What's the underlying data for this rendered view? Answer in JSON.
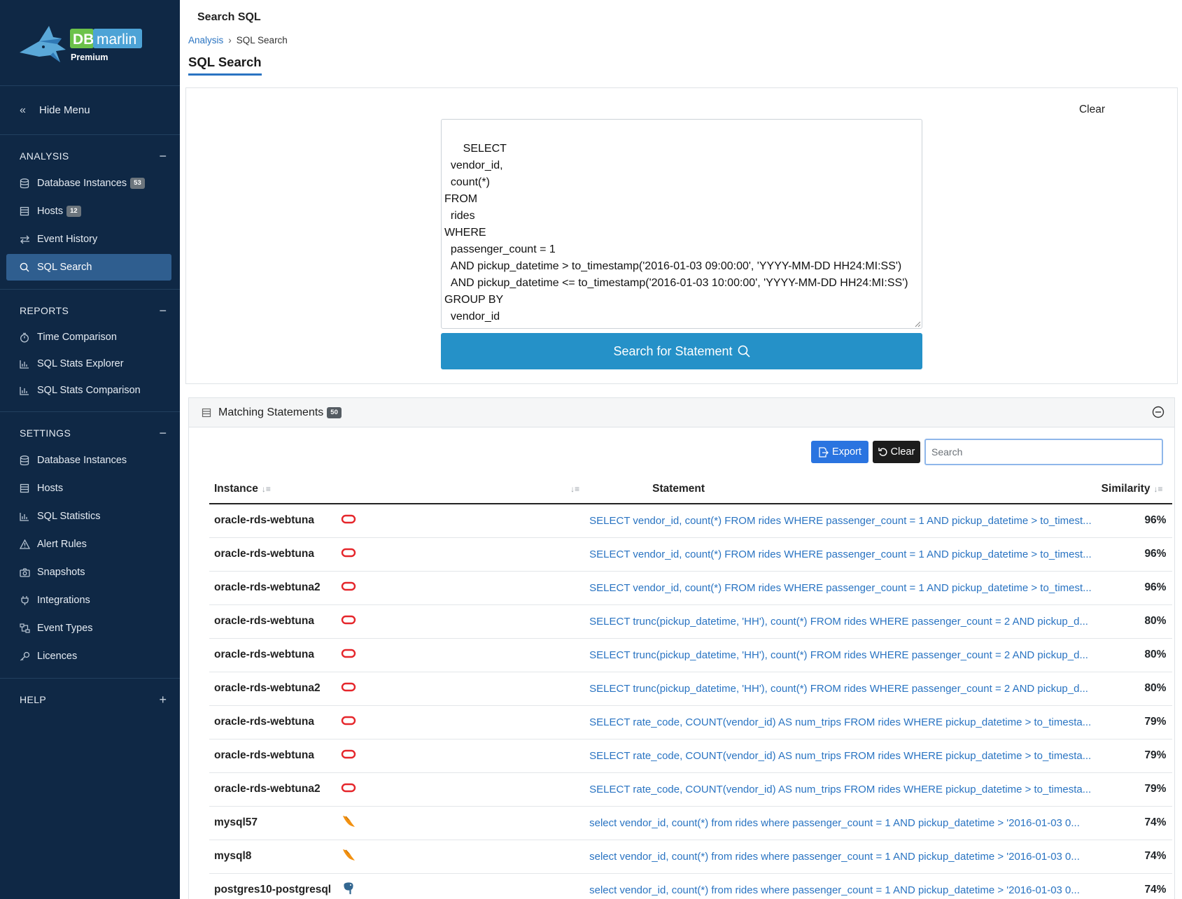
{
  "brand": {
    "logo_text_db": "DB",
    "logo_text_marlin": "marlin",
    "edition": "Premium"
  },
  "sidebar": {
    "hide_menu": "Hide Menu",
    "sections": {
      "analysis": {
        "title": "ANALYSIS",
        "toggle": "−",
        "items": [
          {
            "label": "Database Instances",
            "badge": "53",
            "icon": "database-icon"
          },
          {
            "label": "Hosts",
            "badge": "12",
            "icon": "server-icon"
          },
          {
            "label": "Event History",
            "icon": "arrows-icon"
          },
          {
            "label": "SQL Search",
            "icon": "search-icon",
            "active": true
          }
        ]
      },
      "reports": {
        "title": "REPORTS",
        "toggle": "−",
        "items": [
          {
            "label": "Time Comparison",
            "icon": "stopwatch-icon"
          },
          {
            "label": "SQL Stats Explorer",
            "icon": "bar-chart-icon"
          },
          {
            "label": "SQL Stats Comparison",
            "icon": "bar-chart-icon"
          }
        ]
      },
      "settings": {
        "title": "SETTINGS",
        "toggle": "−",
        "items": [
          {
            "label": "Database Instances",
            "icon": "database-icon"
          },
          {
            "label": "Hosts",
            "icon": "server-icon"
          },
          {
            "label": "SQL Statistics",
            "icon": "bar-chart-icon"
          },
          {
            "label": "Alert Rules",
            "icon": "warning-icon"
          },
          {
            "label": "Snapshots",
            "icon": "camera-icon"
          },
          {
            "label": "Integrations",
            "icon": "plug-icon"
          },
          {
            "label": "Event Types",
            "icon": "diagram-icon"
          },
          {
            "label": "Licences",
            "icon": "key-icon"
          }
        ]
      },
      "help": {
        "title": "HELP",
        "toggle": "+"
      }
    }
  },
  "header": {
    "title": "Search SQL",
    "breadcrumb": {
      "parent": "Analysis",
      "current": "SQL Search"
    },
    "tab": "SQL Search"
  },
  "search": {
    "clear_label": "Clear",
    "sql_text": "SELECT\n  vendor_id,\n  count(*)\nFROM\n  rides\nWHERE\n  passenger_count = 1\n  AND pickup_datetime > to_timestamp('2016-01-03 09:00:00', 'YYYY-MM-DD HH24:MI:SS')\n  AND pickup_datetime <= to_timestamp('2016-01-03 10:00:00', 'YYYY-MM-DD HH24:MI:SS')\nGROUP BY\n  vendor_id",
    "button_label": "Search for Statement"
  },
  "results": {
    "title": "Matching Statements",
    "count_badge": "50",
    "export_label": "Export",
    "clear_label": "Clear",
    "search_placeholder": "Search",
    "columns": {
      "instance": "Instance",
      "statement": "Statement",
      "similarity": "Similarity"
    },
    "rows": [
      {
        "instance": "oracle-rds-webtuna",
        "db_type": "oracle",
        "statement": "SELECT vendor_id, count(*) FROM rides WHERE passenger_count = 1 AND pickup_datetime > to_timest...",
        "similarity": "96%"
      },
      {
        "instance": "oracle-rds-webtuna",
        "db_type": "oracle",
        "statement": "SELECT vendor_id, count(*) FROM rides WHERE passenger_count = 1 AND pickup_datetime > to_timest...",
        "similarity": "96%"
      },
      {
        "instance": "oracle-rds-webtuna2",
        "db_type": "oracle",
        "statement": "SELECT vendor_id, count(*) FROM rides WHERE passenger_count = 1 AND pickup_datetime > to_timest...",
        "similarity": "96%"
      },
      {
        "instance": "oracle-rds-webtuna",
        "db_type": "oracle",
        "statement": "SELECT trunc(pickup_datetime, 'HH'), count(*) FROM rides WHERE passenger_count = 2 AND pickup_d...",
        "similarity": "80%"
      },
      {
        "instance": "oracle-rds-webtuna",
        "db_type": "oracle",
        "statement": "SELECT trunc(pickup_datetime, 'HH'), count(*) FROM rides WHERE passenger_count = 2 AND pickup_d...",
        "similarity": "80%"
      },
      {
        "instance": "oracle-rds-webtuna2",
        "db_type": "oracle",
        "statement": "SELECT trunc(pickup_datetime, 'HH'), count(*) FROM rides WHERE passenger_count = 2 AND pickup_d...",
        "similarity": "80%"
      },
      {
        "instance": "oracle-rds-webtuna",
        "db_type": "oracle",
        "statement": "SELECT rate_code, COUNT(vendor_id) AS num_trips FROM rides WHERE pickup_datetime > to_timesta...",
        "similarity": "79%"
      },
      {
        "instance": "oracle-rds-webtuna",
        "db_type": "oracle",
        "statement": "SELECT rate_code, COUNT(vendor_id) AS num_trips FROM rides WHERE pickup_datetime > to_timesta...",
        "similarity": "79%"
      },
      {
        "instance": "oracle-rds-webtuna2",
        "db_type": "oracle",
        "statement": "SELECT rate_code, COUNT(vendor_id) AS num_trips FROM rides WHERE pickup_datetime > to_timesta...",
        "similarity": "79%"
      },
      {
        "instance": "mysql57",
        "db_type": "mysql",
        "statement": "select vendor_id, count(*) from rides where passenger_count = 1 AND pickup_datetime > '2016-01-03 0...",
        "similarity": "74%"
      },
      {
        "instance": "mysql8",
        "db_type": "mysql",
        "statement": "select vendor_id, count(*) from rides where passenger_count = 1 AND pickup_datetime > '2016-01-03 0...",
        "similarity": "74%"
      },
      {
        "instance": "postgres10-postgresql",
        "db_type": "postgresql",
        "statement": "select vendor_id, count(*) from rides where passenger_count = 1 AND pickup_datetime > '2016-01-03 0...",
        "similarity": "74%"
      }
    ]
  },
  "colors": {
    "sidebar_bg": "#0f2845",
    "active_item": "#2f5e8f",
    "primary_button": "#2591c8",
    "export_button": "#2a74e0",
    "link": "#2a74c2",
    "oracle": "#e5262b",
    "mysql": "#f29111",
    "postgresql": "#336791"
  }
}
